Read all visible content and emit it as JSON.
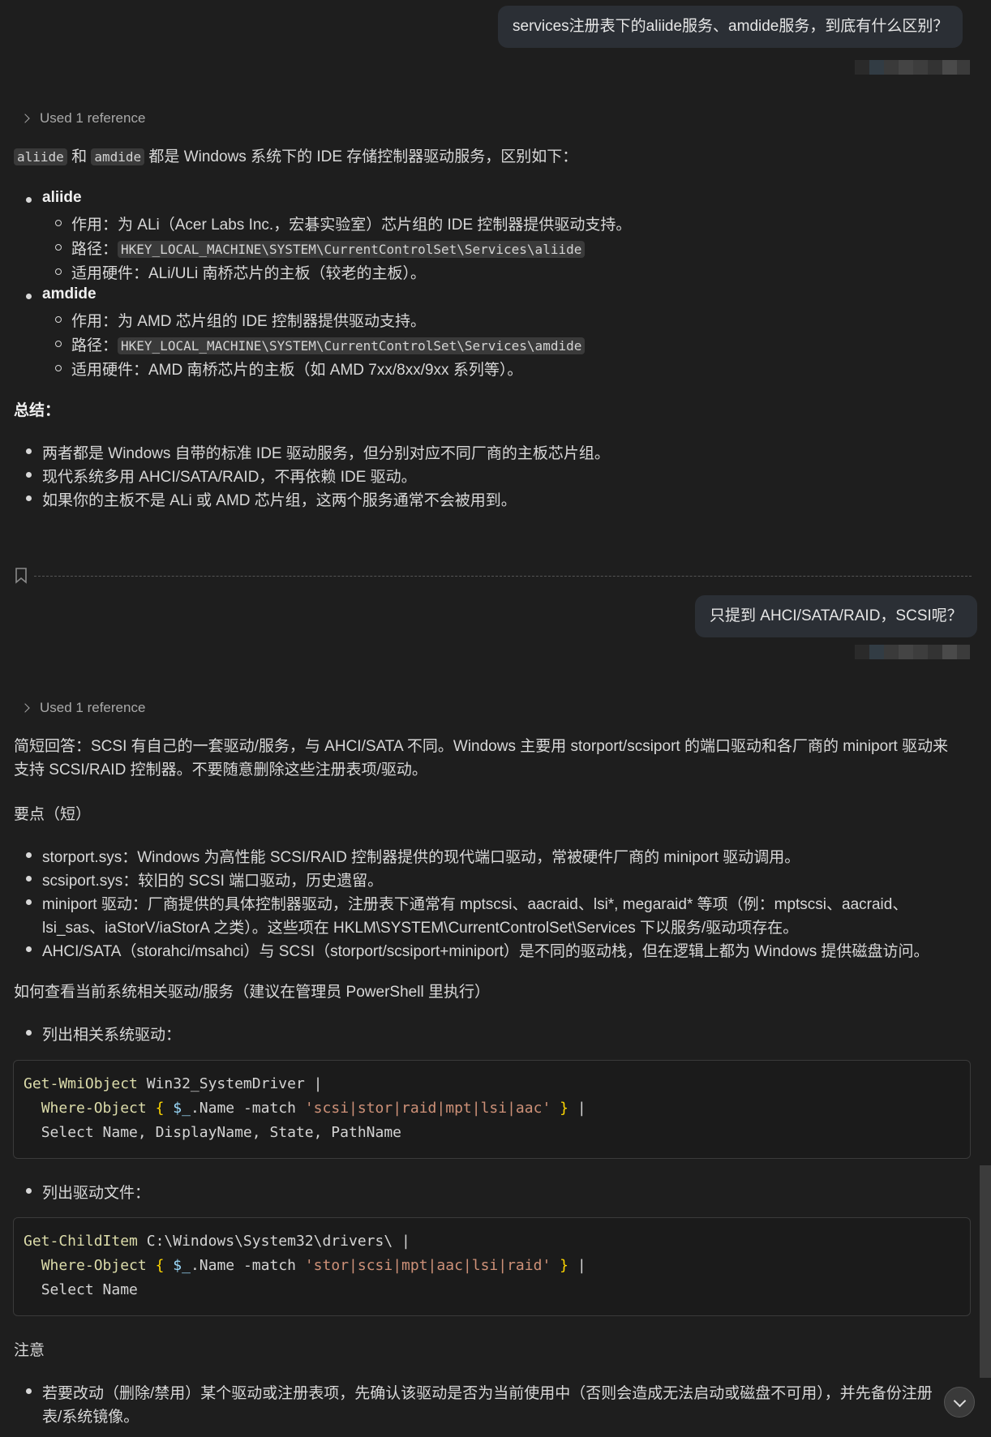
{
  "messages": {
    "user1": "services注册表下的aliide服务、amdide服务，到底有什么区别？",
    "user2": "只提到 AHCI/SATA/RAID，SCSI呢？"
  },
  "ref1": "Used 1 reference",
  "ref2": "Used 1 reference",
  "answer1": {
    "intro_code1": "aliide",
    "intro_and": " 和 ",
    "intro_code2": "amdide",
    "intro_rest": " 都是 Windows 系统下的 IDE 存储控制器驱动服务，区别如下：",
    "aliide": {
      "title": "aliide",
      "role": "作用：为 ALi（Acer Labs Inc.，宏碁实验室）芯片组的 IDE 控制器提供驱动支持。",
      "path_label": "路径：",
      "path": "HKEY_LOCAL_MACHINE\\SYSTEM\\CurrentControlSet\\Services\\aliide",
      "hardware": "适用硬件：ALi/ULi 南桥芯片的主板（较老的主板）。"
    },
    "amdide": {
      "title": "amdide",
      "role": "作用：为 AMD 芯片组的 IDE 控制器提供驱动支持。",
      "path_label": "路径：",
      "path": "HKEY_LOCAL_MACHINE\\SYSTEM\\CurrentControlSet\\Services\\amdide",
      "hardware": "适用硬件：AMD 南桥芯片的主板（如 AMD 7xx/8xx/9xx 系列等）。"
    },
    "summary_title": "总结：",
    "summary": [
      "两者都是 Windows 自带的标准 IDE 驱动服务，但分别对应不同厂商的主板芯片组。",
      "现代系统多用 AHCI/SATA/RAID，不再依赖 IDE 驱动。",
      "如果你的主板不是 ALi 或 AMD 芯片组，这两个服务通常不会被用到。"
    ]
  },
  "answer2": {
    "intro_line1": "简短回答：SCSI 有自己的一套驱动/服务，与 AHCI/SATA 不同。Windows 主要用 storport/scsiport 的端口驱动和各厂商的 miniport 驱动来",
    "intro_line2": "支持 SCSI/RAID 控制器。不要随意删除这些注册表项/驱动。",
    "points_title": "要点（短）",
    "points": [
      "storport.sys：Windows 为高性能 SCSI/RAID 控制器提供的现代端口驱动，常被硬件厂商的 miniport 驱动调用。",
      "scsiport.sys：较旧的 SCSI 端口驱动，历史遗留。",
      "miniport 驱动：厂商提供的具体控制器驱动，注册表下通常有 mptscsi、aacraid、lsi*, megaraid* 等项（例：mptscsi、aacraid、",
      "lsi_sas、iaStorV/iaStorA 之类）。这些项在 HKLM\\SYSTEM\\CurrentControlSet\\Services 下以服务/驱动项存在。",
      "AHCI/SATA（storahci/msahci）与 SCSI（storport/scsiport+miniport）是不同的驱动栈，但在逻辑上都为 Windows 提供磁盘访问。"
    ],
    "howto": "如何查看当前系统相关驱动/服务（建议在管理员 PowerShell 里执行）",
    "list_drivers": "列出相关系统驱动：",
    "code1": {
      "l1_cmd": "Get-WmiObject",
      "l1_arg": " Win32_SystemDriver ",
      "l2_cmd": "Where-Object",
      "l2_var": "$_",
      "l2_prop": ".Name -match ",
      "l2_str": "'scsi|stor|raid|mpt|lsi|aac'",
      "l3": "Select Name, DisplayName, State, PathName"
    },
    "list_files": "列出驱动文件：",
    "code2": {
      "l1_cmd": "Get-ChildItem",
      "l1_arg": " C:\\Windows\\System32\\drivers\\ ",
      "l2_cmd": "Where-Object",
      "l2_var": "$_",
      "l2_prop": ".Name -match ",
      "l2_str": "'stor|scsi|mpt|aac|lsi|raid'",
      "l3": "Select Name"
    },
    "note_title": "注意",
    "note_line1": "若要改动（删除/禁用）某个驱动或注册表项，先确认该驱动是否为当前使用中（否则会造成无法启动或磁盘不可用），并先备份注册",
    "note_line2": "表/系统镜像。"
  }
}
